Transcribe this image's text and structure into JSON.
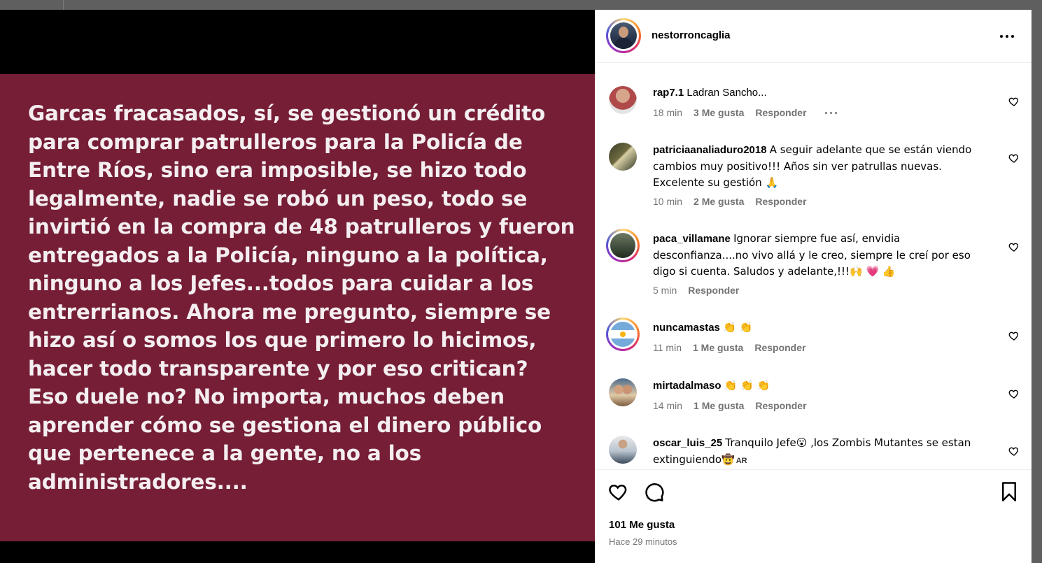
{
  "post": {
    "text": "Garcas fracasados, sí, se gestionó un crédito\npara comprar patrulleros para la Policía de\nEntre Ríos, sino era imposible, se hizo todo\nlegalmente, nadie se robó un peso, todo se\ninvirtió en la compra de 48 patrulleros y fueron\nentregados a la Policía, ninguno a la política,\nninguno a los Jefes...todos para cuidar a los\nentrerrianos. Ahora me pregunto, siempre se\nhizo así o somos los que primero lo hicimos,\nhacer todo transparente y por eso critican?\nEso duele no?  No importa, muchos deben\naprender cómo se gestiona el dinero público\nque pertenece a la gente, no a los\nadministradores....",
    "card_color": "#751e36"
  },
  "header": {
    "username": "nestorroncaglia",
    "more_icon": "more-horizontal-icon"
  },
  "comments": [
    {
      "user": "rap7.1",
      "text": "Ladran Sancho...",
      "time": "18 min",
      "likes": "3 Me gusta",
      "reply": "Responder",
      "has_more": true,
      "ring": false
    },
    {
      "user": "patriciaanaliaduro2018",
      "text": "A seguir adelante que se están viendo cambios muy positivo!!! Años sin ver patrullas nuevas. Excelente su gestión 🙏",
      "time": "10 min",
      "likes": "2 Me gusta",
      "reply": "Responder",
      "has_more": false,
      "ring": false
    },
    {
      "user": "paca_villamane",
      "text": "Ignorar siempre fue así, envidia desconfianza....no vivo allá y le creo, siempre le creí por eso digo si cuenta. Saludos y adelante,!!!🙌 💗 👍",
      "time": "5 min",
      "likes": "",
      "reply": "Responder",
      "has_more": false,
      "ring": true
    },
    {
      "user": "nuncamastas",
      "text": "👏 👏",
      "time": "11 min",
      "likes": "1 Me gusta",
      "reply": "Responder",
      "has_more": false,
      "ring": true
    },
    {
      "user": "mirtadalmaso",
      "text": "👏 👏 👏",
      "time": "14 min",
      "likes": "1 Me gusta",
      "reply": "Responder",
      "has_more": false,
      "ring": false
    },
    {
      "user": "oscar_luis_25",
      "text": "Tranquilo Jefe😮 ,los Zombis Mutantes se estan extinguiendo🤠",
      "badge": "AR",
      "time": "",
      "likes": "",
      "reply": "",
      "has_more": false,
      "ring": false
    }
  ],
  "actions": {
    "like_icon": "heart-icon",
    "comment_icon": "comment-icon",
    "save_icon": "bookmark-icon",
    "likes": "101 Me gusta",
    "time_ago": "Hace 29 minutos"
  },
  "colors": {
    "meta_gray": "#737373",
    "panel_bg": "#ffffff",
    "backdrop": "#5f5f5f"
  }
}
